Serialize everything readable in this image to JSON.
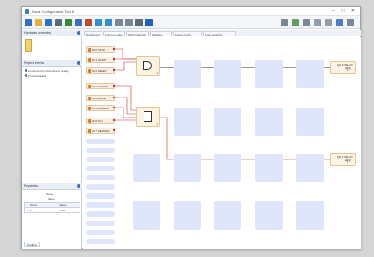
{
  "window": {
    "title": "Nova Configuration Tool 6",
    "controls": [
      "–",
      "□",
      "✕"
    ]
  },
  "toolbar": {
    "buttons": [
      {
        "name": "new-icon",
        "color": "#2f6fd0"
      },
      {
        "name": "open-icon",
        "color": "#e2b23a"
      },
      {
        "name": "save-icon",
        "color": "#2f6fd0"
      },
      {
        "name": "print-icon",
        "color": "#5b6b7d"
      },
      {
        "name": "connect-icon",
        "color": "#3a8a3a"
      },
      {
        "name": "device-icon",
        "color": "#3b6fc2"
      },
      {
        "name": "user-icon",
        "color": "#c24a2a"
      },
      {
        "name": "upload-icon",
        "color": "#2f8fd0"
      },
      {
        "name": "download-icon",
        "color": "#2f8fd0"
      },
      {
        "name": "compare-icon",
        "color": "#7a8896"
      },
      {
        "name": "grid-icon",
        "color": "#7a8896"
      },
      {
        "name": "lock-icon",
        "color": "#5b6b7d"
      },
      {
        "name": "info-icon",
        "color": "#1f5fc2"
      }
    ],
    "right_buttons": [
      {
        "name": "zoom-in-icon",
        "color": "#5b6b7d"
      },
      {
        "name": "zoom-fit-icon",
        "color": "#3a8a3a"
      },
      {
        "name": "search-icon",
        "color": "#5b6b7d"
      },
      {
        "name": "undo-icon",
        "color": "#7a8896"
      },
      {
        "name": "redo-icon",
        "color": "#7a8896"
      },
      {
        "name": "help-icon",
        "color": "#1f5fc2"
      },
      {
        "name": "settings-icon",
        "color": "#5b6b7d"
      }
    ]
  },
  "left_panel": {
    "header_top": "Hardware overview",
    "header_middle": "Project events",
    "events": [
      "Connected to Nova device ready",
      "Project loaded"
    ],
    "header_bottom": "Properties",
    "properties_title": "Name",
    "properties_sub": "Value",
    "prop_columns": [
      "Name",
      "Value"
    ],
    "prop_row": [
      "Gate",
      "AND"
    ],
    "bottom_tab": "Toolbox"
  },
  "tabs": [
    {
      "label": "Dashboard",
      "active": false
    },
    {
      "label": "Function editor",
      "active": true
    },
    {
      "label": "Wiring diagram",
      "active": false
    },
    {
      "label": "Modules",
      "active": false
    },
    {
      "label": "Project report",
      "active": false
    },
    {
      "label": "Logic analyzer",
      "active": false
    }
  ],
  "inputs": [
    {
      "label": "I0.0 STOP"
    },
    {
      "label": "I0.1 START"
    },
    {
      "label": "I0.2 RESET"
    },
    {
      "label": "I0.3 GUARD"
    },
    {
      "label": "I0.4 MODE"
    },
    {
      "label": "I0.5 ENABLE"
    },
    {
      "label": "I0.6 ACK"
    },
    {
      "label": "I0.7 SENSOR"
    }
  ],
  "gates": [
    {
      "id": "1",
      "type": "AND"
    },
    {
      "id": "2",
      "type": "SR"
    }
  ],
  "outputs": [
    {
      "label": "Q0.0 RELAY",
      "symbol": "<|<"
    },
    {
      "label": "Q0.1 RELAY",
      "symbol": "<|<"
    }
  ],
  "colors": {
    "placeholder": "#dfe5fb",
    "wire_red": "#d0342c",
    "wire_dark": "#333333",
    "accent": "#3b6fc2"
  }
}
